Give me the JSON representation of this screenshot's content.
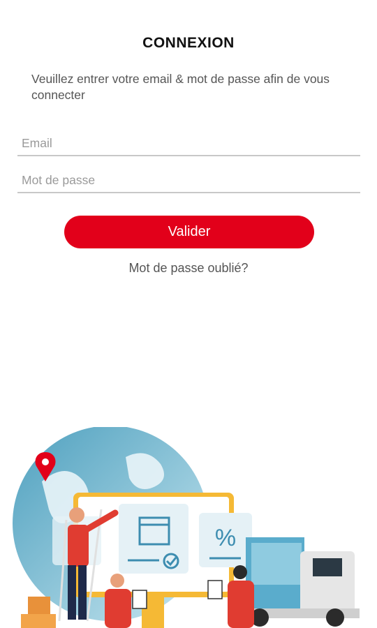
{
  "header": {
    "title": "CONNEXION"
  },
  "intro": {
    "text": "Veuillez entrer votre email & mot de passe afin de vous connecter"
  },
  "form": {
    "email_placeholder": "Email",
    "email_value": "",
    "password_placeholder": "Mot de passe",
    "password_value": "",
    "submit_label": "Valider",
    "forgot_label": "Mot de passe oublié?"
  },
  "colors": {
    "accent": "#e2001a",
    "text": "#555555",
    "title": "#111111"
  },
  "illustration": {
    "icons": [
      "map-pin-icon",
      "window-icon",
      "checkmark-icon",
      "percent-icon"
    ],
    "percent_text": "%"
  }
}
